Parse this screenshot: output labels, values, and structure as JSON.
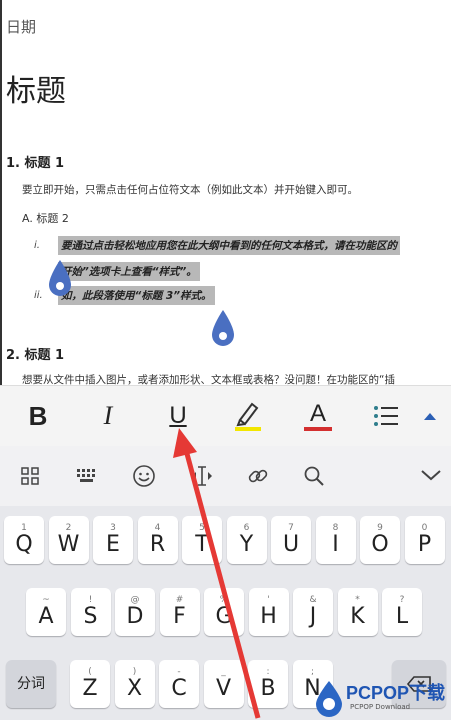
{
  "document": {
    "date_label": "日期",
    "title": "标题",
    "heading1_a": "1. 标题 1",
    "paragraph1": "要立即开始，只需点击任何占位符文本（例如此文本）并开始键入即可。",
    "heading2": "A. 标题 2",
    "roman_i": "i.",
    "roman_ii": "ii.",
    "selected_line1": "要通过点击轻松地应用您在此大纲中看到的任何文本格式，请在功能区的",
    "selected_line2": "开始”选项卡上查看“样式”。",
    "selected_line3": "如，此段落使用“标题 3”样式。",
    "heading1_b": "2. 标题 1",
    "paragraph2": "想要从文件中插入图片，或者添加形状、文本框或表格？没问题！在功能区的“插"
  },
  "format_toolbar": {
    "bold_label": "B",
    "italic_label": "I",
    "underline_label": "U",
    "font_color_label": "A",
    "highlight_color": "#f2e600",
    "font_color": "#d32f2f",
    "icons": [
      "bold-icon",
      "italic-icon",
      "underline-icon",
      "highlighter-icon",
      "font-color-icon",
      "list-icon",
      "expand-up-icon"
    ]
  },
  "keyboard_bar": {
    "icons": [
      "grid-icon",
      "keyboard-icon",
      "emoji-icon",
      "cursor-move-icon",
      "link-icon",
      "search-icon",
      "collapse-icon"
    ]
  },
  "keyboard": {
    "row1": [
      {
        "main": "Q",
        "sub": "1"
      },
      {
        "main": "W",
        "sub": "2"
      },
      {
        "main": "E",
        "sub": "3"
      },
      {
        "main": "R",
        "sub": "4"
      },
      {
        "main": "T",
        "sub": "5"
      },
      {
        "main": "Y",
        "sub": "6"
      },
      {
        "main": "U",
        "sub": "7"
      },
      {
        "main": "I",
        "sub": "8"
      },
      {
        "main": "O",
        "sub": "9"
      },
      {
        "main": "P",
        "sub": "0"
      }
    ],
    "row2": [
      {
        "main": "A",
        "sub": "~"
      },
      {
        "main": "S",
        "sub": "!"
      },
      {
        "main": "D",
        "sub": "@"
      },
      {
        "main": "F",
        "sub": "#"
      },
      {
        "main": "G",
        "sub": "%"
      },
      {
        "main": "H",
        "sub": "'"
      },
      {
        "main": "J",
        "sub": "&"
      },
      {
        "main": "K",
        "sub": "*"
      },
      {
        "main": "L",
        "sub": "?"
      }
    ],
    "row3": [
      {
        "main": "Z",
        "sub": "("
      },
      {
        "main": "X",
        "sub": ")"
      },
      {
        "main": "C",
        "sub": "-"
      },
      {
        "main": "V",
        "sub": "_"
      },
      {
        "main": "B",
        "sub": ":"
      },
      {
        "main": "N",
        "sub": ";"
      }
    ],
    "fn_left": "分词"
  },
  "watermark": {
    "brand": "PCPOP下载",
    "domain": "PCPOP Download"
  },
  "colors": {
    "accent_blue": "#4a6fc1",
    "selection_gray": "#b8b8b8",
    "arrow_red": "#e53935"
  }
}
